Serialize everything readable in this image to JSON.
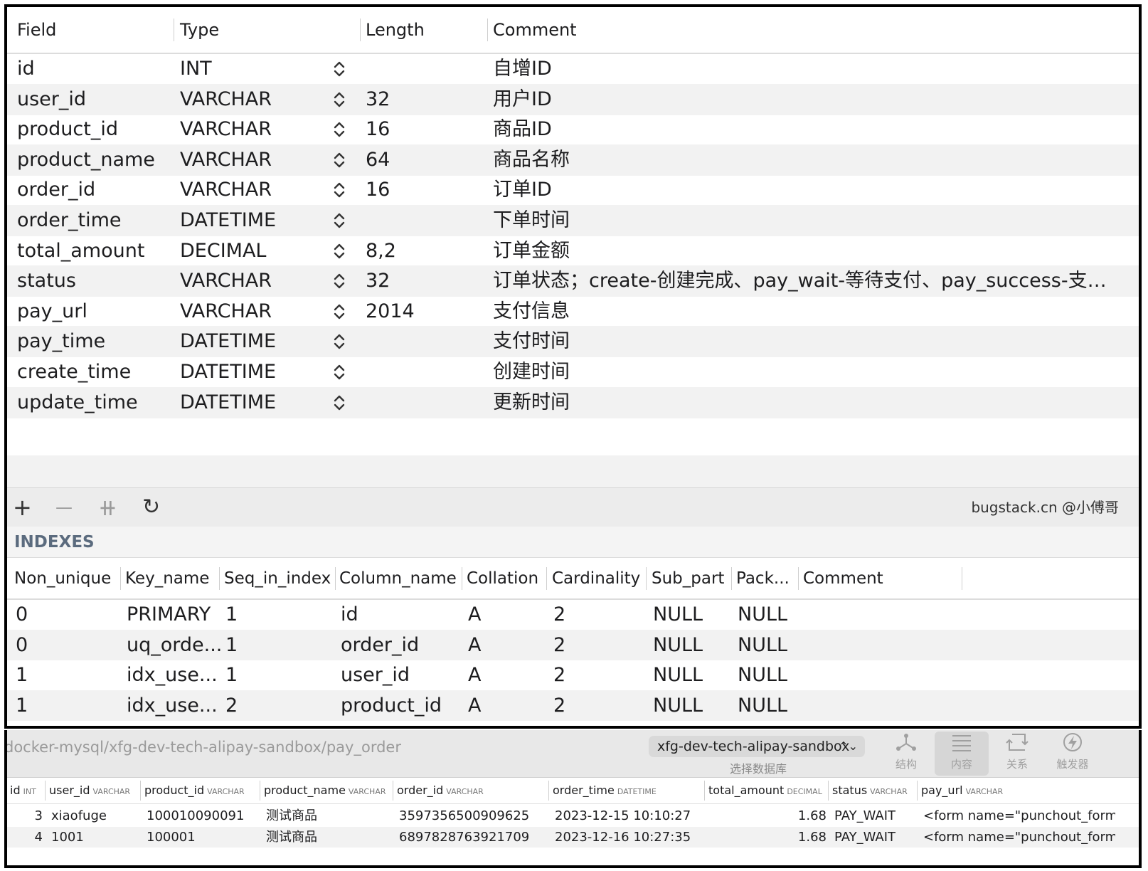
{
  "structure": {
    "headers": {
      "field": "Field",
      "type": "Type",
      "length": "Length",
      "comment": "Comment"
    },
    "rows": [
      {
        "field": "id",
        "type": "INT",
        "length": "",
        "comment": "自增ID"
      },
      {
        "field": "user_id",
        "type": "VARCHAR",
        "length": "32",
        "comment": "用户ID"
      },
      {
        "field": "product_id",
        "type": "VARCHAR",
        "length": "16",
        "comment": "商品ID"
      },
      {
        "field": "product_name",
        "type": "VARCHAR",
        "length": "64",
        "comment": "商品名称"
      },
      {
        "field": "order_id",
        "type": "VARCHAR",
        "length": "16",
        "comment": "订单ID"
      },
      {
        "field": "order_time",
        "type": "DATETIME",
        "length": "",
        "comment": "下单时间"
      },
      {
        "field": "total_amount",
        "type": "DECIMAL",
        "length": "8,2",
        "comment": "订单金额"
      },
      {
        "field": "status",
        "type": "VARCHAR",
        "length": "32",
        "comment": "订单状态；create-创建完成、pay_wait-等待支付、pay_success-支付…"
      },
      {
        "field": "pay_url",
        "type": "VARCHAR",
        "length": "2014",
        "comment": "支付信息"
      },
      {
        "field": "pay_time",
        "type": "DATETIME",
        "length": "",
        "comment": "支付时间"
      },
      {
        "field": "create_time",
        "type": "DATETIME",
        "length": "",
        "comment": "创建时间"
      },
      {
        "field": "update_time",
        "type": "DATETIME",
        "length": "",
        "comment": "更新时间"
      }
    ],
    "stepper_glyph": "⌃⌄"
  },
  "toolbar": {
    "add": "+",
    "remove": "—",
    "duplicate": "⧺",
    "refresh": "↻",
    "watermark": "bugstack.cn @小傅哥"
  },
  "indexes": {
    "label": "INDEXES",
    "headers": [
      "Non_unique",
      "Key_name",
      "Seq_in_index",
      "Column_name",
      "Collation",
      "Cardinality",
      "Sub_part",
      "Pack...",
      "Comment"
    ],
    "rows": [
      [
        "0",
        "PRIMARY",
        "1",
        "id",
        "A",
        "2",
        "NULL",
        "NULL",
        ""
      ],
      [
        "0",
        "uq_orde...",
        "1",
        "order_id",
        "A",
        "2",
        "NULL",
        "NULL",
        ""
      ],
      [
        "1",
        "idx_use...",
        "1",
        "user_id",
        "A",
        "2",
        "NULL",
        "NULL",
        ""
      ],
      [
        "1",
        "idx_use...",
        "2",
        "product_id",
        "A",
        "2",
        "NULL",
        "NULL",
        ""
      ]
    ]
  },
  "content_window": {
    "path": "docker-mysql/xfg-dev-tech-alipay-sandbox/pay_order",
    "database": "xfg-dev-tech-alipay-sandbox",
    "database_caption": "选择数据库",
    "tools": [
      {
        "label": "结构",
        "icon": "structure-icon"
      },
      {
        "label": "内容",
        "icon": "content-icon"
      },
      {
        "label": "关系",
        "icon": "relations-icon"
      },
      {
        "label": "触发器",
        "icon": "triggers-icon"
      }
    ],
    "headers": [
      {
        "name": "id",
        "type": "INT"
      },
      {
        "name": "user_id",
        "type": "VARCHAR"
      },
      {
        "name": "product_id",
        "type": "VARCHAR"
      },
      {
        "name": "product_name",
        "type": "VARCHAR"
      },
      {
        "name": "order_id",
        "type": "VARCHAR"
      },
      {
        "name": "order_time",
        "type": "DATETIME"
      },
      {
        "name": "total_amount",
        "type": "DECIMAL"
      },
      {
        "name": "status",
        "type": "VARCHAR"
      },
      {
        "name": "pay_url",
        "type": "VARCHAR"
      }
    ],
    "rows": [
      [
        "3",
        "xiaofuge",
        "100010090091",
        "测试商品",
        "3597356500909625",
        "2023-12-15 10:10:27",
        "1.68",
        "PAY_WAIT",
        "<form name=\"punchout_form..."
      ],
      [
        "4",
        "1001",
        "100001",
        "测试商品",
        "6897828763921709",
        "2023-12-16 10:27:35",
        "1.68",
        "PAY_WAIT",
        "<form name=\"punchout_form..."
      ]
    ]
  }
}
